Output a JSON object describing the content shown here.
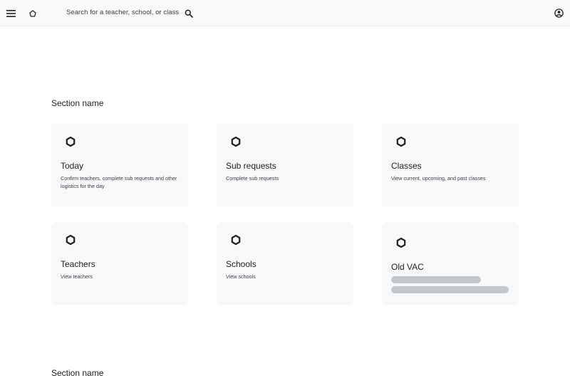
{
  "header": {
    "search_placeholder": "Search for a teacher, school, or class",
    "icons": [
      "menu-icon",
      "home-icon",
      "search-icon",
      "account-icon"
    ]
  },
  "sections": [
    {
      "title": "Section name",
      "cards": [
        {
          "title": "Today",
          "description": "Confirm teachers, complete sub requests and other logistics for the day",
          "icon": "hexagon-icon"
        },
        {
          "title": "Sub requests",
          "description": "Complete sub requests",
          "icon": "hexagon-icon"
        },
        {
          "title": "Classes",
          "description": "View current, upcoming, and past classes",
          "icon": "hexagon-icon"
        },
        {
          "title": "Teachers",
          "description": "View teachers",
          "icon": "hexagon-icon"
        },
        {
          "title": "Schools",
          "description": "View schools",
          "icon": "hexagon-icon"
        },
        {
          "title": "Old VAC",
          "description": "",
          "icon": "hexagon-icon",
          "loading": true
        }
      ]
    },
    {
      "title": "Section name"
    }
  ],
  "colors": {
    "header_bg": "#f8f9fa",
    "card_bg": "#f7f8fa",
    "skeleton": "#c4c7cc",
    "text": "#202124"
  }
}
